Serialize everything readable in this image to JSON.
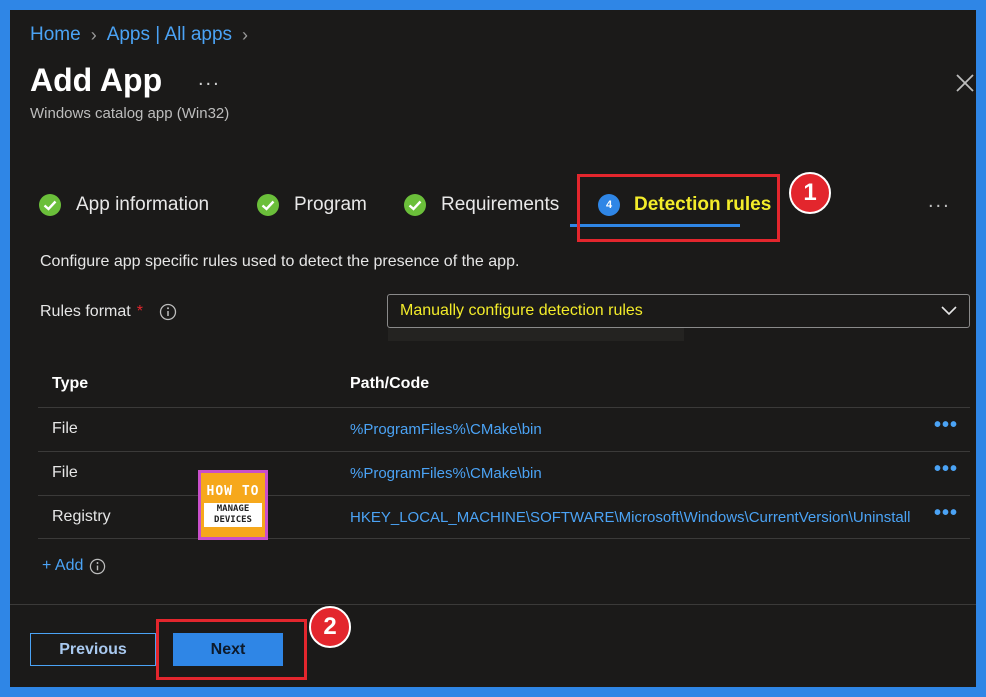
{
  "breadcrumb": {
    "items": [
      "Home",
      "Apps | All apps"
    ]
  },
  "header": {
    "title": "Add App",
    "more": "...",
    "subtitle": "Windows catalog app (Win32)"
  },
  "tabs": [
    {
      "label": "App information",
      "status": "complete"
    },
    {
      "label": "Program",
      "status": "complete"
    },
    {
      "label": "Requirements",
      "status": "complete"
    },
    {
      "label": "Detection rules",
      "step": "4",
      "status": "active"
    }
  ],
  "tabs_more": "...",
  "callouts": {
    "first": "1",
    "second": "2"
  },
  "main": {
    "description": "Configure app specific rules used to detect the presence of the app.",
    "rules_format_label": "Rules format",
    "required_marker": "*",
    "rules_format_value": "Manually configure detection rules"
  },
  "table": {
    "columns": [
      "Type",
      "Path/Code"
    ],
    "rows": [
      {
        "type": "File",
        "path": "%ProgramFiles%\\CMake\\bin"
      },
      {
        "type": "File",
        "path": "%ProgramFiles%\\CMake\\bin"
      },
      {
        "type": "Registry",
        "path": "HKEY_LOCAL_MACHINE\\SOFTWARE\\Microsoft\\Windows\\CurrentVersion\\Uninstall"
      }
    ],
    "row_more": "•••"
  },
  "add_label": "+ Add",
  "footer": {
    "previous_label": "Previous",
    "next_label": "Next"
  },
  "logo": {
    "top": "HOW TO",
    "bottom": "MANAGE DEVICES"
  },
  "colors": {
    "accent": "#2f86e6",
    "link": "#4ba3f5",
    "highlight_text": "#f3ec2a",
    "callout_red": "#e3262d",
    "success": "#6bbf3a"
  }
}
